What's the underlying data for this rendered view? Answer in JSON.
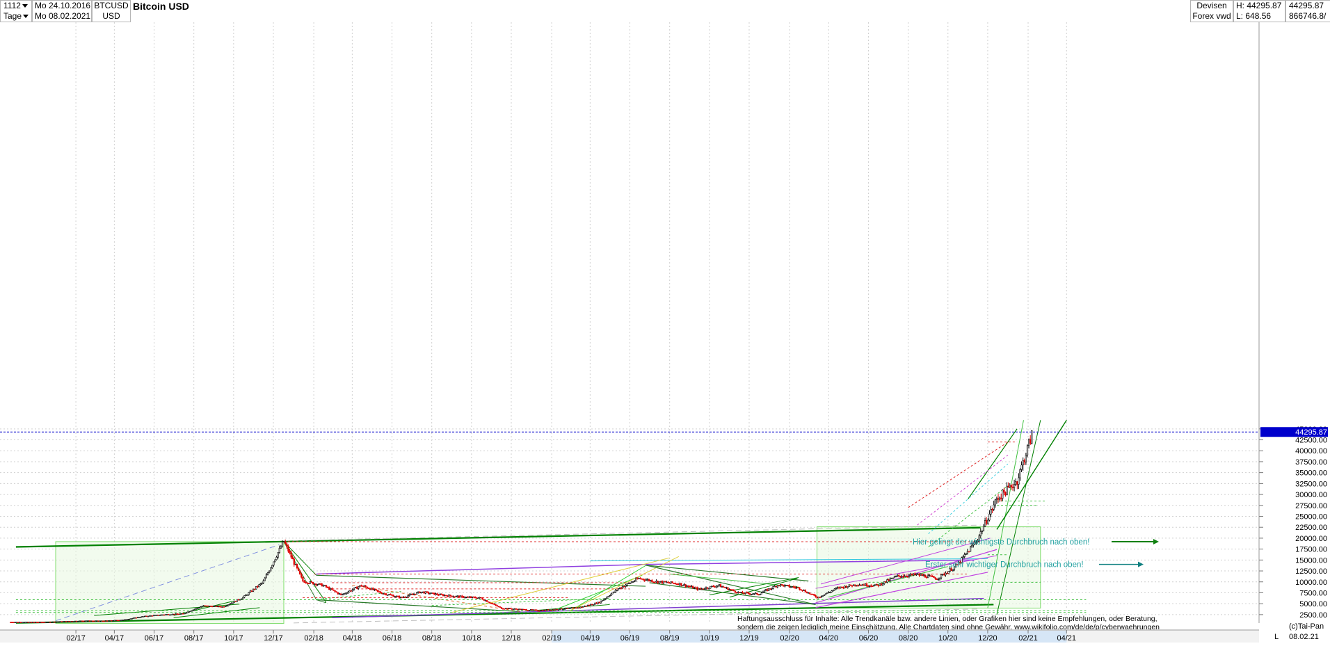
{
  "header": {
    "period_count": "1112",
    "interval": "Tage",
    "date_from": "Mo 24.10.2016",
    "date_to": "Mo 08.02.2021",
    "symbol": "BTCUSD",
    "currency": "USD",
    "title": "Bitcoin USD",
    "market": "Devisen",
    "source": "Forex vwd",
    "high": "H: 44295.87",
    "low": "L: 648.56",
    "high_value_right": "44295.87",
    "low_value_right": "866746.8/"
  },
  "chart_data": {
    "type": "candlestick",
    "title": "Bitcoin USD",
    "y_ticks": [
      2500,
      5000,
      7500,
      10000,
      12500,
      15000,
      17500,
      20000,
      22500,
      25000,
      27500,
      30000,
      32500,
      35000,
      37500,
      40000,
      42500,
      45000
    ],
    "y_tick_labels": [
      "2500.00",
      "5000.00",
      "7500.00",
      "10000.00",
      "12500.00",
      "15000.00",
      "17500.00",
      "20000.00",
      "22500.00",
      "25000.00",
      "27500.00",
      "30000.00",
      "32500.00",
      "35000.00",
      "37500.00",
      "40000.00",
      "42500.00",
      "45000.00"
    ],
    "ylim": [
      500,
      45500
    ],
    "x_ticks": [
      "02/17",
      "04/17",
      "06/17",
      "08/17",
      "10/17",
      "12/17",
      "02/18",
      "04/18",
      "06/18",
      "08/18",
      "10/18",
      "12/18",
      "02/19",
      "04/19",
      "06/19",
      "08/19",
      "10/19",
      "12/19",
      "02/20",
      "04/20",
      "06/20",
      "08/20",
      "10/20",
      "12/20",
      "02/21",
      "04/21"
    ],
    "x_range": [
      "2016-12",
      "2021-05"
    ],
    "last_price_label": "44295.87",
    "last_price": 44295.87,
    "closes": [
      [
        "2016-12",
        780
      ],
      [
        "2017-01",
        960
      ],
      [
        "2017-02",
        1100
      ],
      [
        "2017-03",
        1060
      ],
      [
        "2017-04",
        1300
      ],
      [
        "2017-05",
        2100
      ],
      [
        "2017-06",
        2500
      ],
      [
        "2017-07",
        2700
      ],
      [
        "2017-08",
        4500
      ],
      [
        "2017-09",
        4300
      ],
      [
        "2017-10",
        6400
      ],
      [
        "2017-11",
        9900
      ],
      [
        "2017-12-17",
        19300
      ],
      [
        "2018-01",
        10200
      ],
      [
        "2018-02",
        9200
      ],
      [
        "2018-03",
        7000
      ],
      [
        "2018-04",
        9200
      ],
      [
        "2018-05",
        7500
      ],
      [
        "2018-06",
        6400
      ],
      [
        "2018-07",
        7700
      ],
      [
        "2018-08",
        7000
      ],
      [
        "2018-09",
        6600
      ],
      [
        "2018-10",
        6300
      ],
      [
        "2018-11",
        4000
      ],
      [
        "2018-12",
        3700
      ],
      [
        "2019-01",
        3450
      ],
      [
        "2019-02",
        3800
      ],
      [
        "2019-03",
        4100
      ],
      [
        "2019-04",
        5300
      ],
      [
        "2019-05",
        8500
      ],
      [
        "2019-06",
        10800
      ],
      [
        "2019-07",
        10000
      ],
      [
        "2019-08",
        9600
      ],
      [
        "2019-09",
        8300
      ],
      [
        "2019-10",
        9200
      ],
      [
        "2019-11",
        7500
      ],
      [
        "2019-12",
        7200
      ],
      [
        "2020-01",
        9350
      ],
      [
        "2020-02",
        8600
      ],
      [
        "2020-03",
        6400
      ],
      [
        "2020-04",
        8600
      ],
      [
        "2020-05",
        9450
      ],
      [
        "2020-06",
        9150
      ],
      [
        "2020-07",
        11300
      ],
      [
        "2020-08",
        11650
      ],
      [
        "2020-09",
        10800
      ],
      [
        "2020-10",
        13800
      ],
      [
        "2020-11",
        19700
      ],
      [
        "2020-12",
        29000
      ],
      [
        "2021-01",
        33100
      ],
      [
        "2021-02-08",
        44295
      ]
    ],
    "annotations": [
      "Hier gelingt der wichtigste Durchbruch nach oben!",
      "Erster sehr wichtiger Durchbruch nach oben!"
    ],
    "disclaimer": [
      "Haftungsausschluss für Inhalte: Alle Trendkanäle bzw. andere Linien, oder Grafiken hier sind keine Empfehlungen, oder Beratung,",
      "sondern die zeigen lediglich meine  Einschätzung. Alle Chartdaten sind ohne Gewähr.  www.wikifolio.com/de/de/p/cyberwaehrungen"
    ],
    "footer_left": "(c)Tai-Pan",
    "footer_date": "08.02.21",
    "footer_scale": "L",
    "grid": true,
    "colors": {
      "up": "#000000",
      "down": "#e00000",
      "main_trend": "#008000",
      "price_marker": "#0000cc"
    }
  }
}
